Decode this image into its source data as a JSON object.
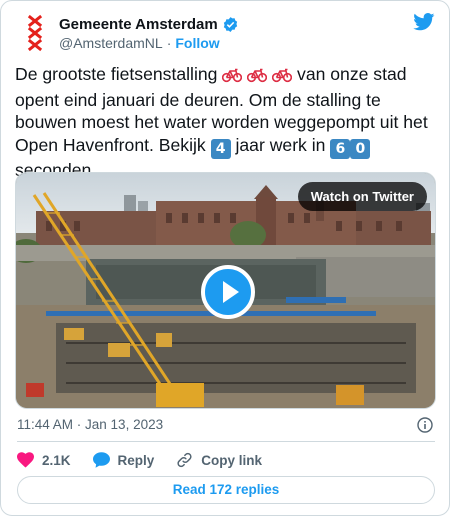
{
  "author": {
    "name": "Gemeente Amsterdam",
    "handle": "@AmsterdamNL",
    "separator": "·",
    "follow_label": "Follow"
  },
  "tweet": {
    "segments": [
      "De grootste fietsenstalling",
      "van onze stad opent eind januari de deuren. Om de stalling te bouwen moest het water worden weggepompt uit het Open Havenfront. Bekijk",
      "4",
      "jaar werk in",
      "6",
      "0",
      "seconden."
    ]
  },
  "media": {
    "watch_label": "Watch on Twitter"
  },
  "meta": {
    "timestamp": "11:44 AM · Jan 13, 2023"
  },
  "actions": {
    "likes": "2.1K",
    "reply_label": "Reply",
    "copy_link_label": "Copy link",
    "read_replies_label": "Read 172 replies"
  },
  "icons": {
    "logo": "amsterdam-xxx-logo",
    "verified": "verified-badge-icon",
    "twitter": "twitter-bird-icon",
    "like": "heart-icon",
    "reply": "speech-bubble-icon",
    "link": "link-icon",
    "info": "info-icon",
    "play": "play-icon",
    "bike": "bicycle-emoji"
  },
  "colors": {
    "accent": "#1d9bf0",
    "heart": "#f91880",
    "keycap": "#3b88c3",
    "logo_red": "#e4211c",
    "muted": "#536471"
  }
}
